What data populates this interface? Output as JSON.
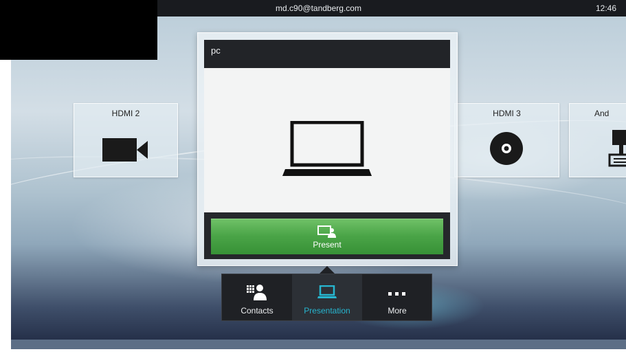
{
  "status_bar": {
    "email": "md.c90@tandberg.com",
    "time": "12:46"
  },
  "sources": {
    "left": {
      "label": "HDMI 2",
      "icon": "video-camera-icon"
    },
    "selected": {
      "label": "pc",
      "icon": "laptop-icon"
    },
    "right": {
      "label": "HDMI 3",
      "icon": "disc-icon"
    },
    "far_right": {
      "label": "And",
      "icon": "document-camera-icon"
    }
  },
  "present_button": {
    "label": "Present",
    "icon": "share-screen-icon"
  },
  "nav": {
    "items": [
      {
        "label": "Contacts",
        "icon": "contacts-icon"
      },
      {
        "label": "Presentation",
        "icon": "presentation-icon"
      },
      {
        "label": "More",
        "icon": "more-icon"
      }
    ],
    "active": "Presentation"
  },
  "colors": {
    "accent": "#27b5cf",
    "present_green": "#4aa447",
    "bar_dark": "#191b1f"
  }
}
